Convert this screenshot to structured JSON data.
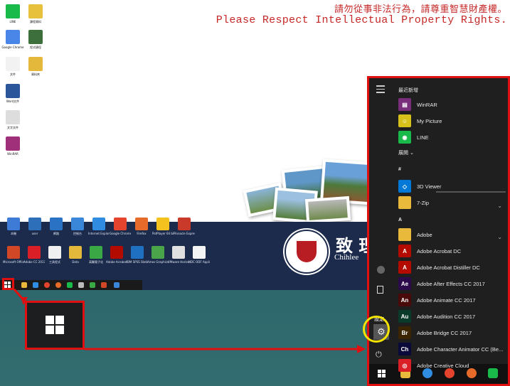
{
  "notice": {
    "line1": "請勿從事非法行為，請尊重智慧財產權。",
    "line2": "Please Respect Intellectual Property Rights."
  },
  "desktop_icons": [
    {
      "label": "LINE",
      "color": "#19b94a"
    },
    {
      "label": "課程資料",
      "color": "#e7c13c"
    },
    {
      "label": "Google Chrome",
      "color": "#4a86e8"
    },
    {
      "label": "程式捷徑",
      "color": "#3c6f3c"
    },
    {
      "label": "文件",
      "color": "#f2f2f2"
    },
    {
      "label": "資料夾",
      "color": "#e4b83a"
    },
    {
      "label": "Word文件",
      "color": "#2b579a"
    },
    {
      "label": "文字文件",
      "color": "#dddddd"
    },
    {
      "label": "WinRAR",
      "color": "#a0307a"
    }
  ],
  "band_icons_row1": [
    {
      "label": "本機",
      "color": "#3d7bd6"
    },
    {
      "label": "user",
      "color": "#2d6fb8"
    },
    {
      "label": "網路",
      "color": "#2a73c4"
    },
    {
      "label": "控制台",
      "color": "#3a86d9"
    },
    {
      "label": "Internet Explorer",
      "color": "#2f8ce0"
    },
    {
      "label": "Google Chrome",
      "color": "#e4432d"
    },
    {
      "label": "Firefox",
      "color": "#e66b2a"
    },
    {
      "label": "PotPlayer 64 bit",
      "color": "#f4c21f"
    },
    {
      "label": "Pinnacle Express",
      "color": "#c93a2a"
    }
  ],
  "band_icons_row2": [
    {
      "label": "Microsoft Office 2013",
      "color": "#d24726"
    },
    {
      "label": "Adobe CC 2017",
      "color": "#da1f26"
    },
    {
      "label": "工具程式",
      "color": "#f0f0f0"
    },
    {
      "label": "Data",
      "color": "#e4b83a"
    },
    {
      "label": "高醫電子化",
      "color": "#39a845"
    },
    {
      "label": "Adobe Acrobat DC",
      "color": "#b30b00"
    },
    {
      "label": "IBM SPSS Statistics 24",
      "color": "#1f70c1"
    },
    {
      "label": "Amos Graphics",
      "color": "#4aa54a"
    },
    {
      "label": "VMware Horizon",
      "color": "#e0e0e0"
    },
    {
      "label": "NDC ODF Application",
      "color": "#f4f4f4"
    }
  ],
  "brand": {
    "cn": "致 理",
    "en": "Chihlee"
  },
  "start_menu": {
    "recent_header": "最近新增",
    "recent": [
      {
        "label": "WinRAR",
        "icon": "winrar-icon",
        "color": "#7a2d7a",
        "glyph": "▤"
      },
      {
        "label": "My Picture",
        "icon": "my-picture-icon",
        "color": "#d6c21a",
        "glyph": "☺"
      },
      {
        "label": "LINE",
        "icon": "line-icon",
        "color": "#19b94a",
        "glyph": "◉"
      }
    ],
    "expand_label": "展開",
    "section_hash": "#",
    "hash_items": [
      {
        "label": "3D Viewer",
        "icon": "3d-viewer-icon",
        "color": "#0078d7",
        "glyph": "◇"
      },
      {
        "label": "7-Zip",
        "icon": "folder-icon",
        "color": "#e8b93a",
        "glyph": ""
      }
    ],
    "section_a": "A",
    "a_items": [
      {
        "label": "Adobe",
        "icon": "folder-icon",
        "color": "#e8b93a",
        "glyph": ""
      },
      {
        "label": "Adobe Acrobat DC",
        "icon": "acrobat-icon",
        "color": "#b30b00",
        "glyph": "A"
      },
      {
        "label": "Adobe Acrobat Distiller DC",
        "icon": "distiller-icon",
        "color": "#b30b00",
        "glyph": "A"
      },
      {
        "label": "Adobe After Effects CC 2017",
        "icon": "after-effects-icon",
        "color": "#2a0a4a",
        "glyph": "Ae"
      },
      {
        "label": "Adobe Animate CC 2017",
        "icon": "animate-icon",
        "color": "#4a0a0a",
        "glyph": "An"
      },
      {
        "label": "Adobe Audition CC 2017",
        "icon": "audition-icon",
        "color": "#0a3a2a",
        "glyph": "Au"
      },
      {
        "label": "Adobe Bridge CC 2017",
        "icon": "bridge-icon",
        "color": "#3a2500",
        "glyph": "Br"
      },
      {
        "label": "Adobe Character Animator CC (Be...",
        "icon": "character-animator-icon",
        "color": "#0a0a3a",
        "glyph": "Ch"
      },
      {
        "label": "Adobe Creative Cloud",
        "icon": "creative-cloud-icon",
        "color": "#da1f26",
        "glyph": "◎"
      }
    ],
    "settings_label": "設定"
  }
}
